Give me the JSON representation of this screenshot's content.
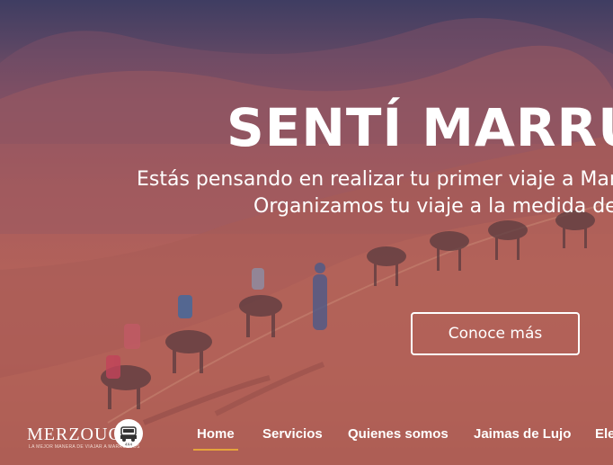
{
  "hero": {
    "title": "SENTÍ MARRU",
    "subtitle_line1": "Estás pensando en realizar tu primer viaje a Mar",
    "subtitle_line2": "Organizamos tu viaje a la medida de",
    "cta_label": "Conoce más"
  },
  "brand": {
    "name": "MERZOUGA",
    "tagline": "LA MEJOR MANERA DE VIAJAR A MARRUECOS",
    "badge_icon": "jeep-4x4-icon",
    "badge_text": "4X4"
  },
  "nav": {
    "items": [
      {
        "label": "Home",
        "active": true
      },
      {
        "label": "Servicios"
      },
      {
        "label": "Quienes somos"
      },
      {
        "label": "Jaimas de Lujo"
      },
      {
        "label": "Ele"
      }
    ]
  },
  "colors": {
    "active_underline": "#e5a33b",
    "overlay_top": "#3f3d62",
    "overlay_mid": "#b3625a"
  }
}
